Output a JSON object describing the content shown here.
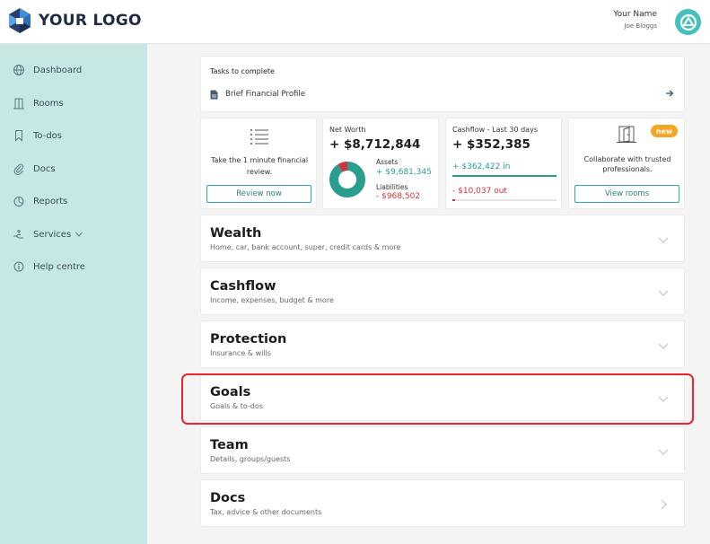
{
  "header": {
    "logo_text": "YOUR LOGO",
    "user_name": "Your Name",
    "user_sub": "Joe Bloggs"
  },
  "sidebar": {
    "items": [
      {
        "label": "Dashboard",
        "icon": "globe-icon"
      },
      {
        "label": "Rooms",
        "icon": "building-icon"
      },
      {
        "label": "To-dos",
        "icon": "bookmark-icon"
      },
      {
        "label": "Docs",
        "icon": "paperclip-icon"
      },
      {
        "label": "Reports",
        "icon": "pie-chart-icon"
      },
      {
        "label": "Services",
        "icon": "hand-icon"
      },
      {
        "label": "Help centre",
        "icon": "info-icon"
      }
    ]
  },
  "tasks": {
    "title": "Tasks to complete",
    "item": "Brief Financial Profile"
  },
  "review_card": {
    "text": "Take the 1 minute financial review.",
    "button": "Review now"
  },
  "networth_card": {
    "title": "Net Worth",
    "value": "+ $8,712,844",
    "assets_label": "Assets",
    "assets_value": "+ $9,681,345",
    "liabilities_label": "Liabilities",
    "liabilities_value": "- $968,502",
    "assets_share": 0.909
  },
  "cashflow_card": {
    "title": "Cashflow - Last 30 days",
    "value": "+ $352,385",
    "in_value": "+ $362,422",
    "in_label": "in",
    "out_value": "- $10,037",
    "out_label": "out",
    "in_fill": 1.0,
    "out_fill": 0.03
  },
  "rooms_card": {
    "badge": "new",
    "text": "Collaborate with trusted professionals.",
    "button": "View rooms"
  },
  "sections": [
    {
      "title": "Wealth",
      "sub": "Home, car, bank account, super, credit cards & more"
    },
    {
      "title": "Cashflow",
      "sub": "Income, expenses, budget & more"
    },
    {
      "title": "Protection",
      "sub": "Insurance & wills"
    },
    {
      "title": "Goals",
      "sub": "Goals & to-dos"
    },
    {
      "title": "Team",
      "sub": "Details, groups/guests"
    },
    {
      "title": "Docs",
      "sub": "Tax, advice & other documents"
    }
  ],
  "colors": {
    "accent": "#34a8a6",
    "sidebar": "#c6e7e4",
    "positive": "#2a9d8f",
    "negative": "#d0333f",
    "highlight": "#e8262b",
    "badge": "#f5a623"
  }
}
